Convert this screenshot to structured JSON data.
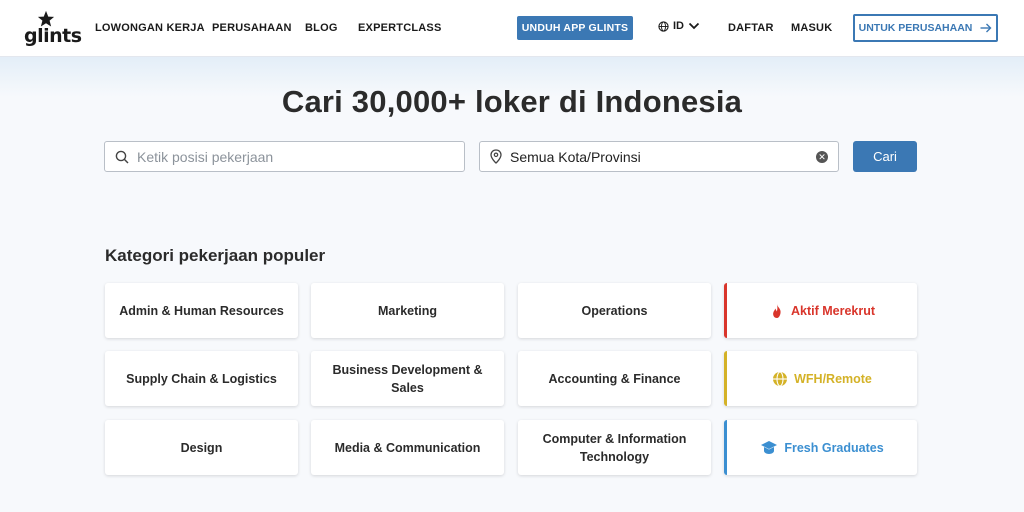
{
  "nav": {
    "logo_text": "glints",
    "links": [
      "LOWONGAN KERJA",
      "PERUSAHAAN",
      "BLOG",
      "EXPERTCLASS"
    ],
    "download_app": "UNDUH APP GLINTS",
    "language": "ID",
    "register": "DAFTAR",
    "login": "MASUK",
    "for_company": "UNTUK PERUSAHAAN"
  },
  "hero": {
    "headline": "Cari 30,000+ loker di Indonesia",
    "position_placeholder": "Ketik posisi pekerjaan",
    "location_value": "Semua Kota/Provinsi",
    "search_button": "Cari"
  },
  "categories": {
    "title": "Kategori pekerjaan populer",
    "items": [
      "Admin & Human Resources",
      "Marketing",
      "Operations",
      "Supply Chain & Logistics",
      "Business Development & Sales",
      "Accounting & Finance",
      "Design",
      "Media & Communication",
      "Computer & Information Technology"
    ],
    "special": [
      {
        "label": "Aktif Merekrut",
        "color": "#d9352b",
        "icon": "fire-icon"
      },
      {
        "label": "WFH/Remote",
        "color": "#d4b227",
        "icon": "globe-icon"
      },
      {
        "label": "Fresh Graduates",
        "color": "#3b8fd1",
        "icon": "graduation-cap-icon"
      }
    ]
  },
  "colors": {
    "primary": "#3b78b4"
  }
}
